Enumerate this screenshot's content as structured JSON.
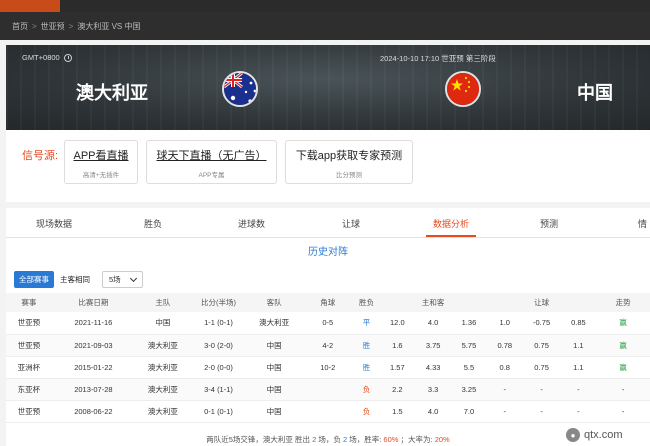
{
  "breadcrumb": [
    "首页",
    "世亚预",
    "澳大利亚 VS 中国"
  ],
  "header": {
    "timezone": "GMT+0800",
    "match_info": "2024-10-10 17:10  世亚预 第三阶段",
    "home_team": "澳大利亚",
    "away_team": "中国"
  },
  "signals": {
    "label": "信号源:",
    "items": [
      {
        "title": "APP看直播",
        "sub": "高清+无插件"
      },
      {
        "title": "球天下直播（无广告）",
        "sub": "APP专属"
      },
      {
        "title": "下载app获取专家预测",
        "sub": "比分预测"
      }
    ]
  },
  "tabs": [
    "现场数据",
    "胜负",
    "进球数",
    "让球",
    "数据分析",
    "预测",
    "情"
  ],
  "active_tab": "数据分析",
  "section_title": "历史对阵",
  "filters": {
    "all": "全部赛事",
    "home": "主客相同",
    "count": "5场"
  },
  "table": {
    "headers": [
      "赛事",
      "比赛日期",
      "主队",
      "比分(半场)",
      "客队",
      "角球",
      "胜负",
      "主和客",
      "",
      "",
      "让球",
      "",
      "",
      "走势"
    ],
    "rows": [
      [
        "世亚预",
        "2021-11-16",
        "中国",
        "1-1 (0-1)",
        "澳大利亚",
        "0-5",
        "平",
        "12.0",
        "4.0",
        "1.36",
        "1.0",
        "-0.75",
        "0.85",
        "赢"
      ],
      [
        "世亚预",
        "2021-09-03",
        "澳大利亚",
        "3-0 (2-0)",
        "中国",
        "4-2",
        "胜",
        "1.6",
        "3.75",
        "5.75",
        "0.78",
        "0.75",
        "1.1",
        "赢"
      ],
      [
        "亚洲杯",
        "2015-01-22",
        "澳大利亚",
        "2-0 (0-0)",
        "中国",
        "10-2",
        "胜",
        "1.57",
        "4.33",
        "5.5",
        "0.8",
        "0.75",
        "1.1",
        "赢"
      ],
      [
        "东亚杯",
        "2013-07-28",
        "澳大利亚",
        "3-4 (1-1)",
        "中国",
        "",
        "负",
        "2.2",
        "3.3",
        "3.25",
        "-",
        "-",
        "-",
        "-"
      ],
      [
        "世亚预",
        "2008-06-22",
        "澳大利亚",
        "0-1 (0-1)",
        "中国",
        "",
        "负",
        "1.5",
        "4.0",
        "7.0",
        "-",
        "-",
        "-",
        "-"
      ]
    ]
  },
  "summary": {
    "prefix": "两队近5场交锋，澳大利亚 胜出",
    "wins": "2",
    "mid1": "场，负",
    "losses": "2",
    "mid2": "场，胜率:",
    "win_rate": "60%",
    "mid3": "；大率为:",
    "big_rate": "20%"
  },
  "watermark": "qtx.com",
  "colors": {
    "accent": "#e8491d",
    "link": "#2a7ad5",
    "win": "#2aa04a"
  }
}
